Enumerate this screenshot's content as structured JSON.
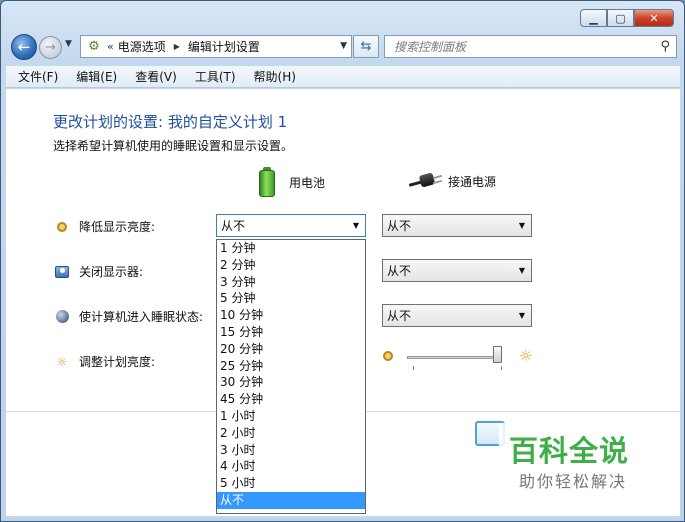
{
  "window": {
    "caption_buttons": {
      "minimize": "minimize-icon",
      "maximize": "maximize-icon",
      "close": "close-icon"
    }
  },
  "nav": {
    "back_icon": "back-arrow-icon",
    "forward_icon": "forward-arrow-icon",
    "address": {
      "prefix": "«",
      "crumbs": [
        "电源选项",
        "编辑计划设置"
      ]
    },
    "refresh_icon": "refresh-icon",
    "search": {
      "placeholder": "搜索控制面板",
      "icon": "search-icon"
    }
  },
  "menu": {
    "items": [
      "文件(F)",
      "编辑(E)",
      "查看(V)",
      "工具(T)",
      "帮助(H)"
    ]
  },
  "main": {
    "title": "更改计划的设置: 我的自定义计划 1",
    "description": "选择希望计算机使用的睡眠设置和显示设置。",
    "columns": {
      "battery": "用电池",
      "plugged_in": "接通电源"
    },
    "rows": [
      {
        "label": "降低显示亮度:",
        "battery_value": "从不",
        "plugged_value": "从不"
      },
      {
        "label": "关闭显示器:",
        "plugged_value": "从不"
      },
      {
        "label": "使计算机进入睡眠状态:",
        "plugged_value": "从不"
      },
      {
        "label": "调整计划亮度:"
      }
    ],
    "brightness": {
      "battery_level": null,
      "plugged_level": 0.95
    },
    "dropdown": {
      "options": [
        "1 分钟",
        "2 分钟",
        "3 分钟",
        "5 分钟",
        "10 分钟",
        "15 分钟",
        "20 分钟",
        "25 分钟",
        "30 分钟",
        "45 分钟",
        "1 小时",
        "2 小时",
        "3 小时",
        "4 小时",
        "5 小时",
        "从不"
      ],
      "selected": "从不"
    }
  },
  "watermark": {
    "title": "百科全说",
    "subtitle": "助你轻松解决"
  },
  "colors": {
    "title_blue": "#1e4f9c",
    "selection": "#3399ff",
    "watermark_green": "#3fae49"
  }
}
